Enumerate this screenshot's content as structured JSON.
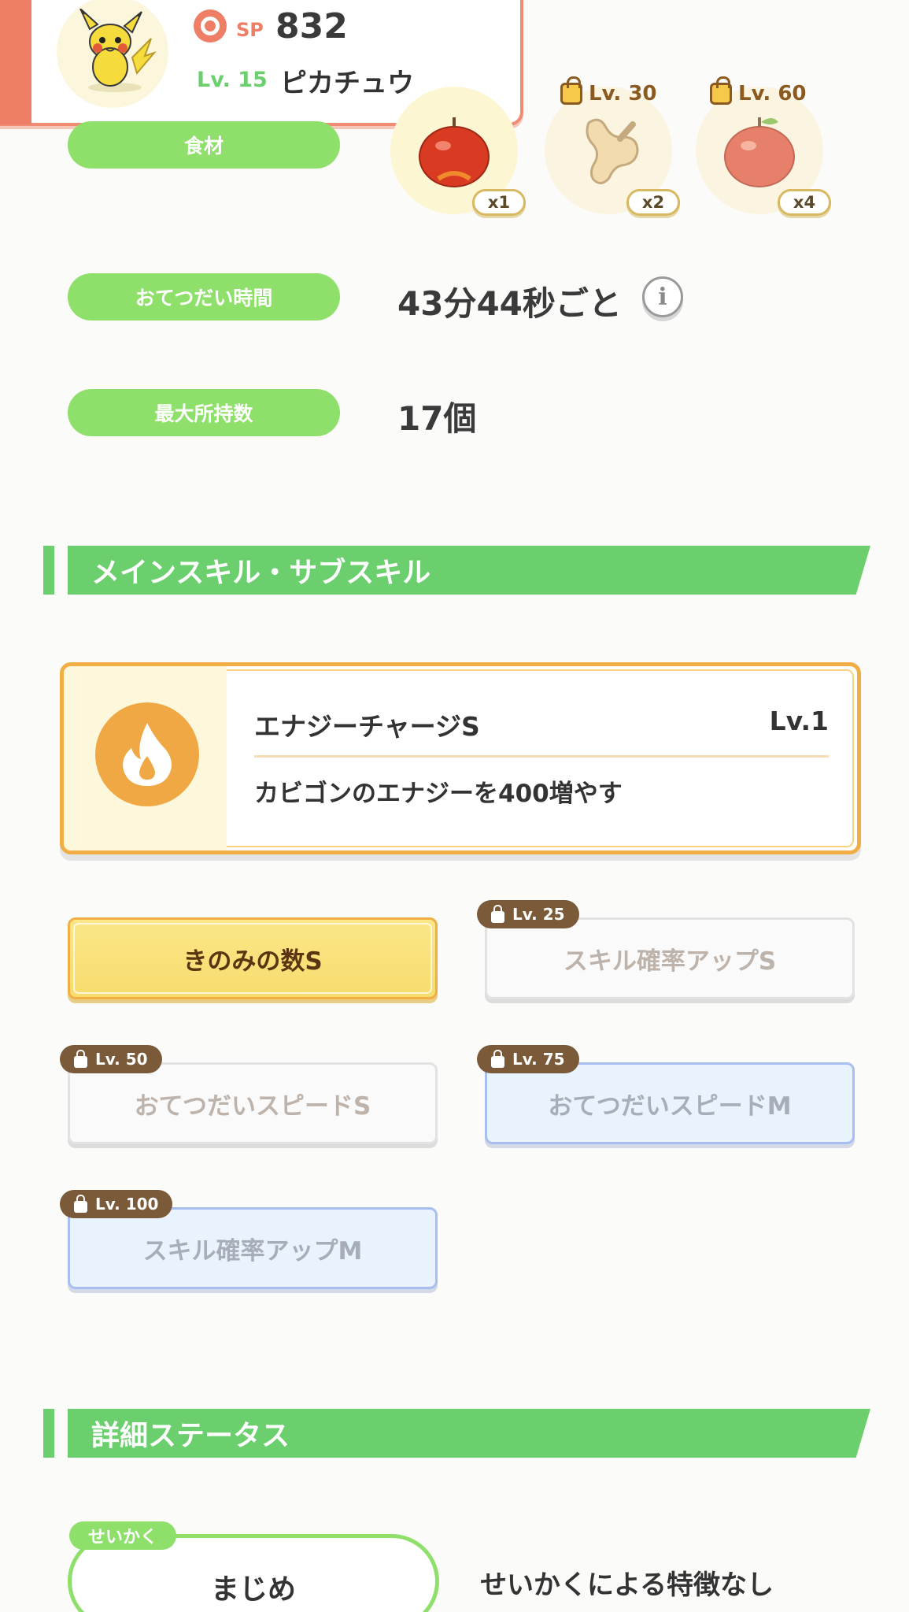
{
  "header": {
    "sp_label": "SP",
    "sp_value": "832",
    "level": "Lv. 15",
    "name": "ピカチュウ"
  },
  "stats": {
    "ingredients_label": "食材",
    "ingredients": [
      {
        "name": "apple-icon",
        "count": "x1",
        "unlocked": true
      },
      {
        "name": "ginger-icon",
        "count": "x2",
        "unlock_level": "Lv. 30",
        "unlocked": false
      },
      {
        "name": "apple-icon",
        "count": "x4",
        "unlock_level": "Lv. 60",
        "unlocked": false
      }
    ],
    "help_time_label": "おてつだい時間",
    "help_time_value": "43分44秒ごと",
    "max_carry_label": "最大所持数",
    "max_carry_value": "17個"
  },
  "skills": {
    "section_title": "メインスキル・サブスキル",
    "main_skill": {
      "name": "エナジーチャージS",
      "level": "Lv.1",
      "description": "カビゴンのエナジーを400増やす"
    },
    "sub_skills": [
      {
        "label": "きのみの数S",
        "lock": ""
      },
      {
        "label": "スキル確率アップS",
        "lock": "Lv. 25"
      },
      {
        "label": "おてつだいスピードS",
        "lock": "Lv. 50"
      },
      {
        "label": "おてつだいスピードM",
        "lock": "Lv. 75"
      },
      {
        "label": "スキル確率アップM",
        "lock": "Lv. 100"
      }
    ]
  },
  "details": {
    "section_title": "詳細ステータス",
    "nature_tag": "せいかく",
    "nature_value": "まじめ",
    "nature_desc": "せいかくによる特徴なし"
  },
  "colors": {
    "accent_green": "#6bcf6e",
    "pill_green": "#8ee06b",
    "header_accent": "#ef7e66",
    "skill_orange": "#f0a844"
  }
}
